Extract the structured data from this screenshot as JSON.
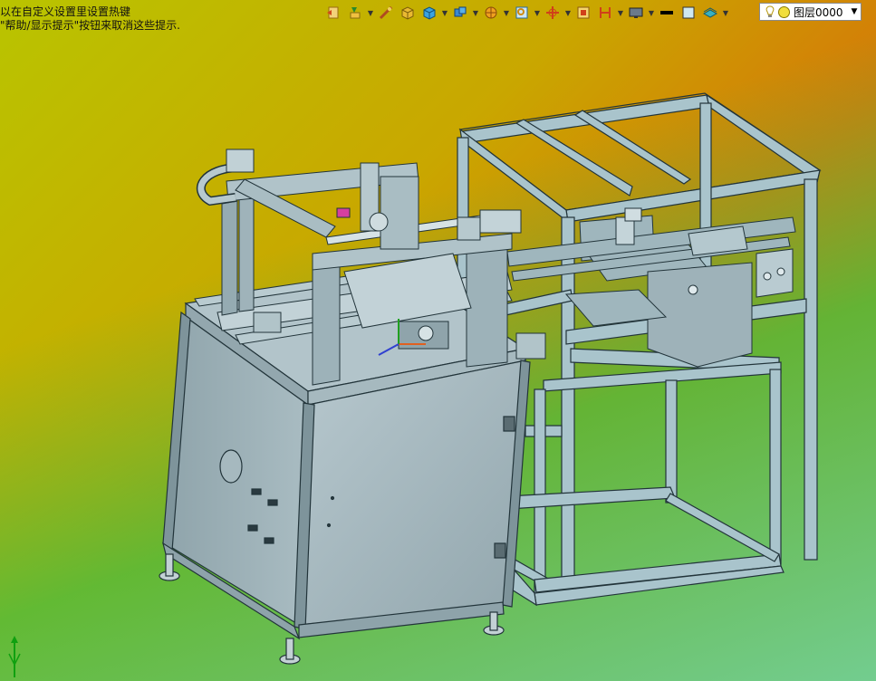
{
  "hint": {
    "line1": "以在自定义设置里设置热键",
    "line2": "\"帮助/显示提示\"按钮来取消这些提示."
  },
  "toolbar": {
    "items": [
      {
        "icon": "previous-view-icon"
      },
      {
        "icon": "view-orient-icon",
        "dropdown": true
      },
      {
        "icon": "section-view-icon"
      },
      {
        "icon": "shaded-cube-icon"
      },
      {
        "icon": "display-style-icon",
        "dropdown": true
      },
      {
        "icon": "hide-show-icon",
        "dropdown": true
      },
      {
        "icon": "appearance-icon",
        "dropdown": true
      },
      {
        "icon": "zoom-area-icon",
        "dropdown": true
      },
      {
        "icon": "rotate-icon",
        "dropdown": true
      },
      {
        "icon": "fit-window-icon"
      },
      {
        "icon": "dimension-icon",
        "dropdown": true
      },
      {
        "icon": "monitor-icon",
        "dropdown": true
      },
      {
        "icon": "line-color-icon"
      },
      {
        "icon": "fill-color-icon"
      },
      {
        "icon": "layer-surface-icon",
        "dropdown": true
      }
    ]
  },
  "layer_select": {
    "value": "图层0000"
  },
  "colors": {
    "frame": "#a9c4cc",
    "frame_dark": "#6d8a93",
    "cabinet": "#a2b6bd",
    "edge": "#22343a"
  }
}
